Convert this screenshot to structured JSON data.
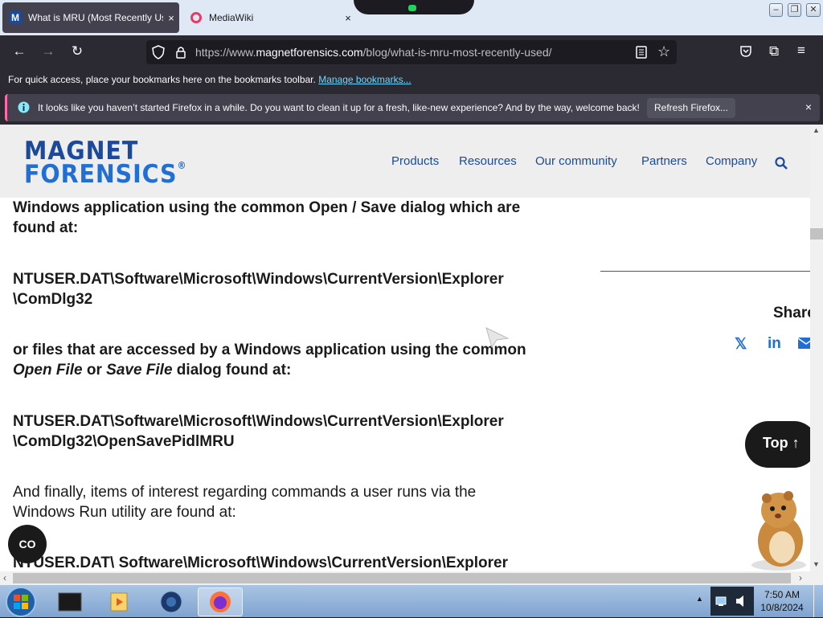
{
  "browser": {
    "tabs": [
      {
        "title": "What is MRU (Most Recently Used",
        "favicon_letter": "M",
        "close": "×"
      },
      {
        "title": "MediaWiki",
        "close": "×"
      }
    ],
    "url_prefix": "https://www.",
    "url_domain": "magnetforensics.com",
    "url_path": "/blog/what-is-mru-most-recently-used/",
    "bookmarks_text": "For quick access, place your bookmarks here on the bookmarks toolbar.",
    "bookmarks_link": "Manage bookmarks...",
    "notification_text": "It looks like you haven’t started Firefox in a while. Do you want to clean it up for a fresh, like-new experience? And by the way, welcome back!",
    "notification_button": "Refresh Firefox...",
    "notification_close": "×"
  },
  "site": {
    "logo_line1": "MAGNET",
    "logo_line2": "FORENSICS",
    "logo_mark": "®",
    "nav": [
      "Products",
      "Resources",
      "Our community",
      "Partners",
      "Company"
    ]
  },
  "article": {
    "p1": "Windows application using the common Open / Save dialog which are found at:",
    "path1_line1": "NTUSER.DAT\\Software\\Microsoft\\Windows\\CurrentVersion\\Explorer",
    "path1_line2": "\\ComDlg32",
    "p2_start": "or files that are accessed by a Windows application using the common",
    "p2_italic1": "Open File",
    "p2_mid": " or ",
    "p2_italic2": "Save File",
    "p2_end": " dialog found at:",
    "path2_line1": "NTUSER.DAT\\Software\\Microsoft\\Windows\\CurrentVersion\\Explorer",
    "path2_line2": "\\ComDlg32\\OpenSavePidlMRU",
    "p3": "And finally, items of interest regarding commands a user runs via the Windows Run utility are found at:",
    "path3_line1": "NTUSER.DAT\\ Software\\Microsoft\\Windows\\CurrentVersion\\Explorer"
  },
  "sidebar": {
    "share_label": "Share",
    "x_icon": "𝕏",
    "linkedin_icon": "in",
    "top_label": "Top",
    "top_arrow": "↑",
    "chat_label": "CO"
  },
  "taskbar": {
    "time": "7:50 AM",
    "date": "10/8/2024"
  }
}
